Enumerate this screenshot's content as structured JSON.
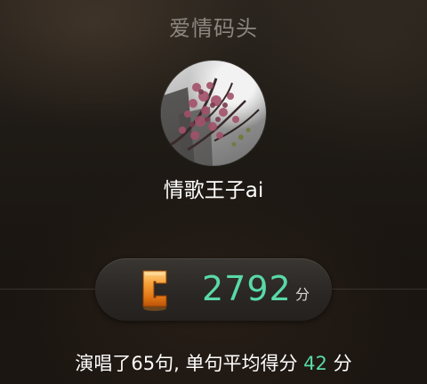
{
  "header": {
    "title": "爱情码头"
  },
  "profile": {
    "username": "情歌王子ai",
    "avatar_icon": "photo-avatar"
  },
  "score": {
    "grade": "C",
    "grade_icon": "grade-c-badge-icon",
    "value": "2792",
    "unit": "分"
  },
  "summary": {
    "prefix": "演唱了65句, 单句平均得分",
    "average": "42",
    "suffix": "分"
  },
  "colors": {
    "accent_green": "#59d9a6",
    "grade_orange": "#f08a1c",
    "title_gray": "#8b8780"
  }
}
